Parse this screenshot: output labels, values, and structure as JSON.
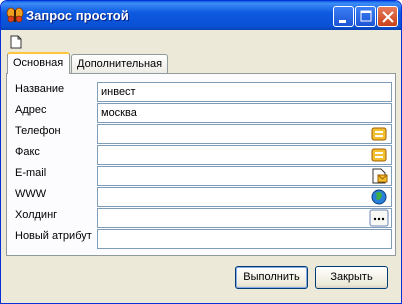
{
  "window": {
    "title": "Запрос простой",
    "icon": "butterfly-app-icon"
  },
  "toolbar": {
    "new_icon": "new-document-icon"
  },
  "tabs": [
    {
      "label": "Основная",
      "active": true
    },
    {
      "label": "Дополнительная",
      "active": false
    }
  ],
  "fields": [
    {
      "label": "Название",
      "value": "инвест"
    },
    {
      "label": "Адрес",
      "value": "москва"
    },
    {
      "label": "Телефон",
      "value": "",
      "button_icon": "phone-book-icon"
    },
    {
      "label": "Факс",
      "value": "",
      "button_icon": "fax-book-icon"
    },
    {
      "label": "E-mail",
      "value": "",
      "button_icon": "email-icon"
    },
    {
      "label": "WWW",
      "value": "",
      "button_icon": "globe-icon"
    },
    {
      "label": "Холдинг",
      "value": "",
      "button_icon": "ellipsis-icon"
    },
    {
      "label": "Новый атрибут",
      "value": ""
    }
  ],
  "buttons": {
    "ok_label": "Выполнить",
    "close_label": "Закрыть"
  }
}
